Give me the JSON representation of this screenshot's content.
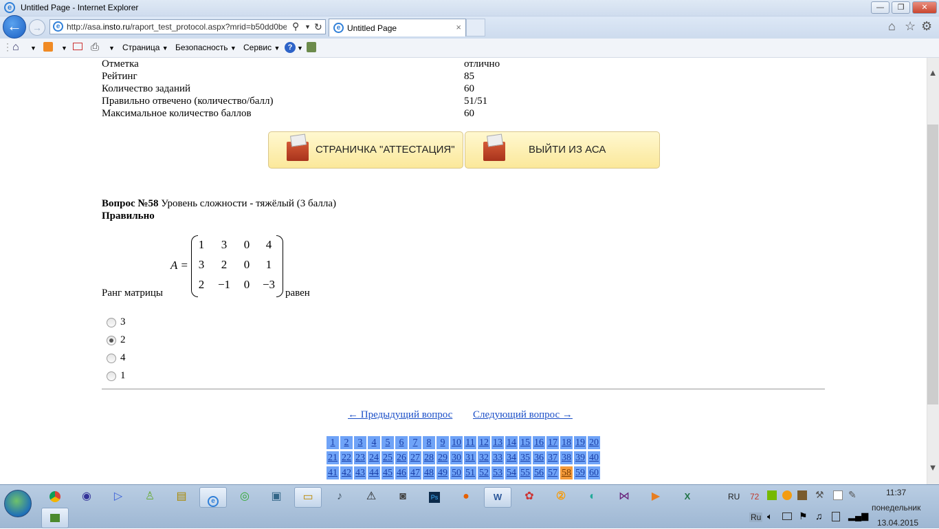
{
  "window": {
    "title": "Untitled Page - Internet Explorer",
    "minimize_symbol": "—",
    "restore_symbol": "❐",
    "close_symbol": "✕"
  },
  "navbar": {
    "back_symbol": "←",
    "forward_symbol": "→",
    "url_prefix": "http://asa.",
    "url_host": "insto.ru",
    "url_rest": "/raport_test_protocol.aspx?mrid=b50dd0be",
    "tab_title": "Untitled Page",
    "tab_close": "×"
  },
  "cmdbar": {
    "page": "Страница",
    "security": "Безопасность",
    "service": "Сервис",
    "help": "?"
  },
  "summary": [
    {
      "label": "Отметка",
      "value": "отлично"
    },
    {
      "label": "Рейтинг",
      "value": "85"
    },
    {
      "label": "Количество заданий",
      "value": "60"
    },
    {
      "label": "Правильно отвечено (количество/балл)",
      "value": "51/51"
    },
    {
      "label": "Максимальное количество баллов",
      "value": "60"
    }
  ],
  "buttons": {
    "attestation": "СТРАНИЧКА \"АТТЕСТАЦИЯ\"",
    "exit": "ВЫЙТИ ИЗ АСА"
  },
  "question": {
    "number_label": "Вопрос №58",
    "difficulty": "Уровень сложности - тяжёлый (3 балла)",
    "status": "Правильно",
    "prefix": "Ранг матрицы",
    "suffix": "равен",
    "matrix_name": "A =",
    "matrix": [
      [
        "1",
        "3",
        "0",
        "4"
      ],
      [
        "3",
        "2",
        "0",
        "1"
      ],
      [
        "2",
        "−1",
        "0",
        "−3"
      ]
    ],
    "options": [
      "3",
      "2",
      "4",
      "1"
    ],
    "selected_index": 1
  },
  "navigation": {
    "prev": "← Предыдущий вопрос",
    "next": "Следующий вопрос →"
  },
  "pages": {
    "rows": [
      [
        "1",
        "2",
        "3",
        "4",
        "5",
        "6",
        "7",
        "8",
        "9",
        "10",
        "11",
        "12",
        "13",
        "14",
        "15",
        "16",
        "17",
        "18",
        "19",
        "20"
      ],
      [
        "21",
        "22",
        "23",
        "24",
        "25",
        "26",
        "27",
        "28",
        "29",
        "30",
        "31",
        "32",
        "33",
        "34",
        "35",
        "36",
        "37",
        "38",
        "39",
        "40"
      ],
      [
        "41",
        "42",
        "43",
        "44",
        "45",
        "46",
        "47",
        "48",
        "49",
        "50",
        "51",
        "52",
        "53",
        "54",
        "55",
        "56",
        "57",
        "58",
        "59",
        "60"
      ]
    ],
    "current": "58",
    "colors": {
      "normal": "#6fa3f7",
      "current": "#f49a3a"
    }
  },
  "taskbar": {
    "lang_top": "RU",
    "temp": "72",
    "lang_bottom": "Ru",
    "time": "11:37",
    "day": "понедельник",
    "date": "13.04.2015"
  }
}
